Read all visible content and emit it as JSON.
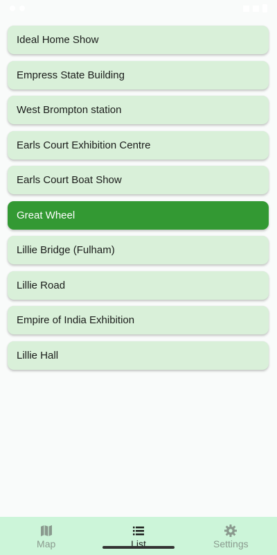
{
  "places": [
    {
      "label": "Ideal Home Show",
      "selected": false
    },
    {
      "label": "Empress State Building",
      "selected": false
    },
    {
      "label": "West Brompton station",
      "selected": false
    },
    {
      "label": "Earls Court Exhibition Centre",
      "selected": false
    },
    {
      "label": "Earls Court Boat Show",
      "selected": false
    },
    {
      "label": "Great Wheel",
      "selected": true
    },
    {
      "label": "Lillie Bridge (Fulham)",
      "selected": false
    },
    {
      "label": "Lillie Road",
      "selected": false
    },
    {
      "label": "Empire of India Exhibition",
      "selected": false
    },
    {
      "label": "Lillie Hall",
      "selected": false
    }
  ],
  "bottom_nav": {
    "items": [
      {
        "label": "Map",
        "icon": "map-icon",
        "active": false
      },
      {
        "label": "List",
        "icon": "list-icon",
        "active": true
      },
      {
        "label": "Settings",
        "icon": "gear-icon",
        "active": false
      }
    ]
  },
  "colors": {
    "item_bg": "#d9f0d9",
    "selected_bg": "#339933",
    "nav_bg": "#ccf5d9"
  }
}
